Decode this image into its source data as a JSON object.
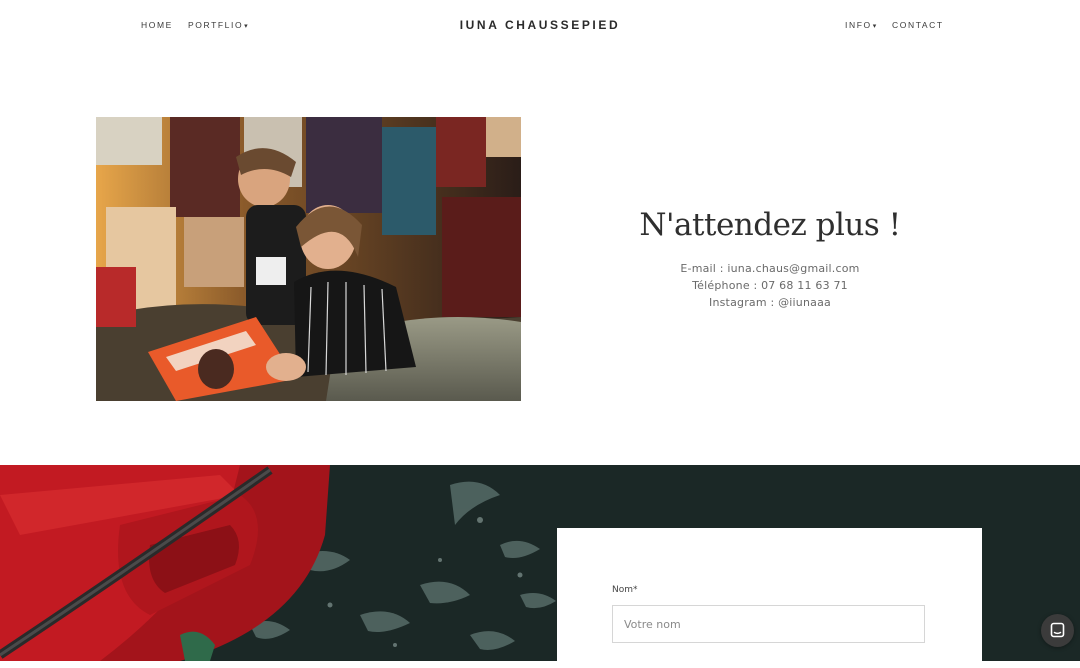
{
  "header": {
    "brand": "IUNA CHAUSSEPIED",
    "nav_left": [
      {
        "label": "HOME"
      },
      {
        "label": "PORTFLIO",
        "dropdown": true
      }
    ],
    "nav_right": [
      {
        "label": "INFO",
        "dropdown": true
      },
      {
        "label": "CONTACT"
      }
    ],
    "caret": "▾"
  },
  "contact": {
    "title": "N'attendez plus !",
    "email_line": "E-mail : iuna.chaus@gmail.com",
    "phone_line": "Téléphone : 07 68 11 63 71",
    "instagram_line": "Instagram : @iiunaaa"
  },
  "form": {
    "name_label": "Nom*",
    "name_placeholder": "Votre nom",
    "name_value": ""
  },
  "icons": {
    "chat": "chat-icon"
  },
  "colors": {
    "boat_red": "#b3131a",
    "water": "#1c2a28",
    "text_dark": "#2f2f2f",
    "text_muted": "#6a6a6a"
  }
}
